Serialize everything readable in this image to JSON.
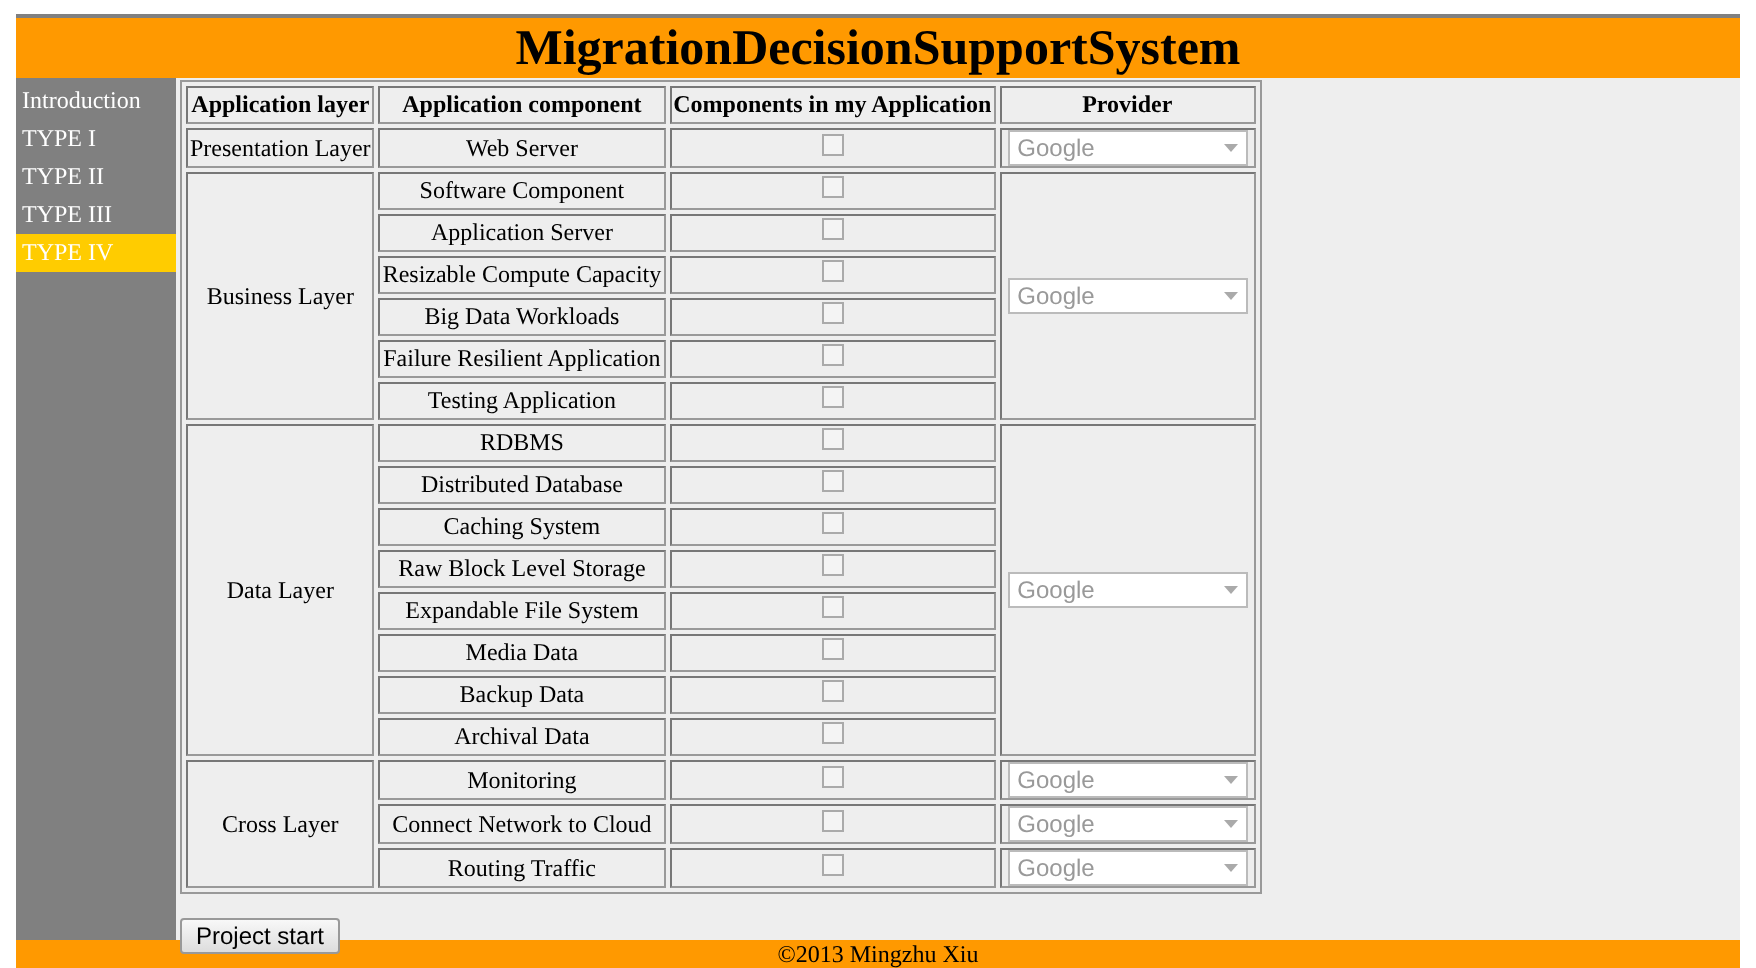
{
  "header": {
    "title": "MigrationDecisionSupportSystem"
  },
  "sidebar": {
    "items": [
      {
        "label": "Introduction",
        "selected": false
      },
      {
        "label": "TYPE I",
        "selected": false
      },
      {
        "label": "TYPE II",
        "selected": false
      },
      {
        "label": "TYPE III",
        "selected": false
      },
      {
        "label": "TYPE IV",
        "selected": true
      }
    ]
  },
  "table": {
    "columns": [
      "Application layer",
      "Application component",
      "Components in my Application",
      "Provider"
    ],
    "groups": [
      {
        "layer": "Presentation Layer",
        "rows": [
          {
            "component": "Web Server",
            "checked": false
          }
        ],
        "providers": [
          {
            "value": "Google",
            "disabled": true
          }
        ]
      },
      {
        "layer": "Business Layer",
        "rows": [
          {
            "component": "Software Component",
            "checked": false
          },
          {
            "component": "Application Server",
            "checked": false
          },
          {
            "component": "Resizable Compute Capacity",
            "checked": false
          },
          {
            "component": "Big Data Workloads",
            "checked": false
          },
          {
            "component": "Failure Resilient Application",
            "checked": false
          },
          {
            "component": "Testing Application",
            "checked": false
          }
        ],
        "providers": [
          {
            "value": "Google",
            "disabled": true
          }
        ]
      },
      {
        "layer": "Data Layer",
        "rows": [
          {
            "component": "RDBMS",
            "checked": false
          },
          {
            "component": "Distributed Database",
            "checked": false
          },
          {
            "component": "Caching System",
            "checked": false
          },
          {
            "component": "Raw Block Level Storage",
            "checked": false
          },
          {
            "component": "Expandable File System",
            "checked": false
          },
          {
            "component": "Media Data",
            "checked": false
          },
          {
            "component": "Backup Data",
            "checked": false
          },
          {
            "component": "Archival Data",
            "checked": false
          }
        ],
        "providers": [
          {
            "value": "Google",
            "disabled": true
          }
        ]
      },
      {
        "layer": "Cross Layer",
        "rows": [
          {
            "component": "Monitoring",
            "checked": false
          },
          {
            "component": "Connect Network to Cloud",
            "checked": false
          },
          {
            "component": "Routing Traffic",
            "checked": false
          }
        ],
        "providers": [
          {
            "value": "Google",
            "disabled": true
          },
          {
            "value": "Google",
            "disabled": true
          },
          {
            "value": "Google",
            "disabled": true
          }
        ]
      }
    ]
  },
  "button": "Project start",
  "footer": "©2013 Mingzhu Xiu"
}
